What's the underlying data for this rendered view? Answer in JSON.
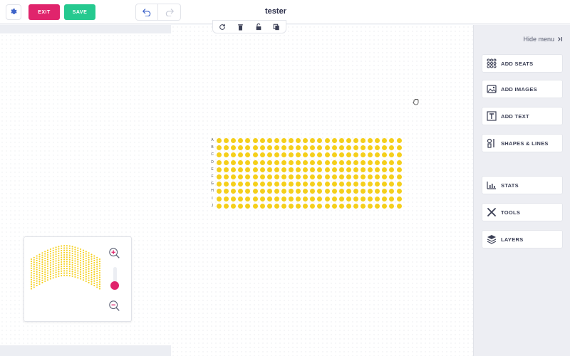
{
  "header": {
    "exit_label": "EXIT",
    "save_label": "SAVE",
    "title": "tester"
  },
  "seat_map": {
    "rows": [
      "A",
      "B",
      "C",
      "D",
      "E",
      "F",
      "G",
      "H",
      "I",
      "J"
    ],
    "seats_per_row": 26,
    "seat_color": "#f5cf1a"
  },
  "sidebar": {
    "hide_menu_label": "Hide menu",
    "buttons": [
      {
        "label": "ADD SEATS",
        "icon": "seats-grid-icon"
      },
      {
        "label": "ADD IMAGES",
        "icon": "image-icon"
      },
      {
        "label": "ADD TEXT",
        "icon": "text-box-icon"
      },
      {
        "label": "SHAPES & LINES",
        "icon": "shapes-icon"
      },
      {
        "label": "STATS",
        "icon": "bar-chart-icon"
      },
      {
        "label": "TOOLS",
        "icon": "tools-icon"
      },
      {
        "label": "LAYERS",
        "icon": "layers-icon"
      }
    ]
  },
  "colors": {
    "accent_pink": "#e0246c",
    "accent_green": "#25c98f",
    "seat_yellow": "#f5cf1a",
    "icon_blue": "#3d63c9"
  }
}
